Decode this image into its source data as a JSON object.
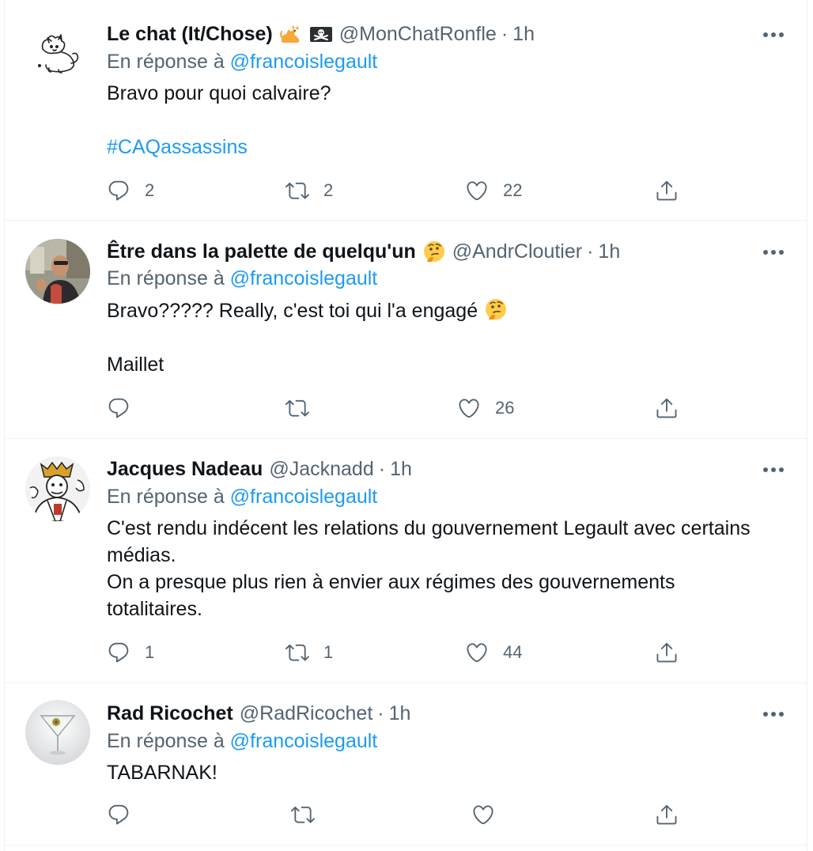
{
  "tweets": [
    {
      "name": "Le chat (It/Chose)",
      "handle": "@MonChatRonfle",
      "dot": "·",
      "time": "1h",
      "reply_prefix": "En réponse à",
      "reply_to": "@francoislegault",
      "lines": [
        "Bravo pour quoi calvaire?",
        "",
        "#CAQassassins"
      ],
      "replies": "2",
      "retweets": "2",
      "likes": "22",
      "name_emojis": [
        "cat-emoji",
        "pirate-flag-emoji"
      ]
    },
    {
      "name": "Être dans la palette de quelqu'un",
      "handle": "@AndrCloutier",
      "dot": "·",
      "time": "1h",
      "reply_prefix": "En réponse à",
      "reply_to": "@francoislegault",
      "lines": [
        "Bravo????? Really, c'est toi qui l'a engagé",
        "",
        "Maillet"
      ],
      "replies": "",
      "retweets": "",
      "likes": "26",
      "name_emojis": [
        "thinking-face-emoji"
      ]
    },
    {
      "name": "Jacques Nadeau",
      "handle": "@Jacknadd",
      "dot": "·",
      "time": "1h",
      "reply_prefix": "En réponse à",
      "reply_to": "@francoislegault",
      "lines": [
        "C'est rendu indécent les relations du gouvernement Legault avec certains",
        "médias.",
        "On a presque plus  rien à envier aux régimes des gouvernements",
        "totalitaires."
      ],
      "replies": "1",
      "retweets": "1",
      "likes": "44",
      "name_emojis": []
    },
    {
      "name": "Rad Ricochet",
      "handle": "@RadRicochet",
      "dot": "·",
      "time": "1h",
      "reply_prefix": "En réponse à",
      "reply_to": "@francoislegault",
      "lines": [
        "TABARNAK!"
      ],
      "replies": "",
      "retweets": "",
      "likes": "",
      "name_emojis": []
    }
  ],
  "icons": {
    "more": "more-horizontal-icon",
    "reply": "reply-bubble-icon",
    "retweet": "retweet-icon",
    "like": "heart-icon",
    "share": "share-upload-icon"
  },
  "colors": {
    "link": "#1d9bf0",
    "muted": "#536471",
    "text": "#0f1419",
    "border": "#eff3f4"
  }
}
